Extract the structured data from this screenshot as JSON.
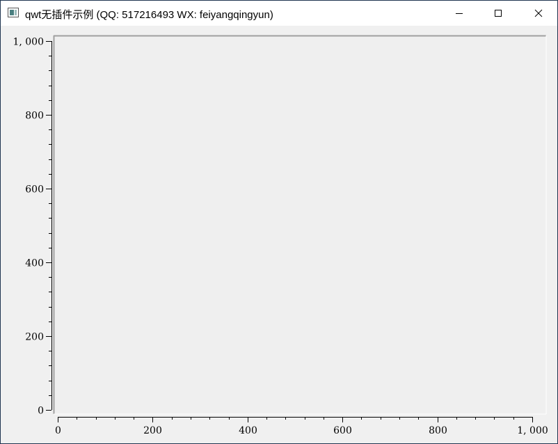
{
  "window": {
    "title": "qwt无插件示例 (QQ: 517216493 WX: feiyangqingyun)",
    "icon": "app-window-icon",
    "controls": {
      "minimize": "minimize-icon",
      "maximize": "maximize-icon",
      "close": "close-icon"
    }
  },
  "chart_data": {
    "type": "line",
    "title": "",
    "xlabel": "",
    "ylabel": "",
    "xlim": [
      0,
      1000
    ],
    "ylim": [
      0,
      1000
    ],
    "x_major_ticks": [
      0,
      200,
      400,
      600,
      800,
      1000
    ],
    "y_major_ticks": [
      0,
      200,
      400,
      600,
      800,
      1000
    ],
    "x_tick_labels": [
      "0",
      "200",
      "400",
      "600",
      "800",
      "1, 000"
    ],
    "y_tick_labels": [
      "0",
      "200",
      "400",
      "600",
      "800",
      "1, 000"
    ],
    "minor_ticks_per_major": 4,
    "series": [],
    "grid": false,
    "canvas_color": "#efefef"
  }
}
